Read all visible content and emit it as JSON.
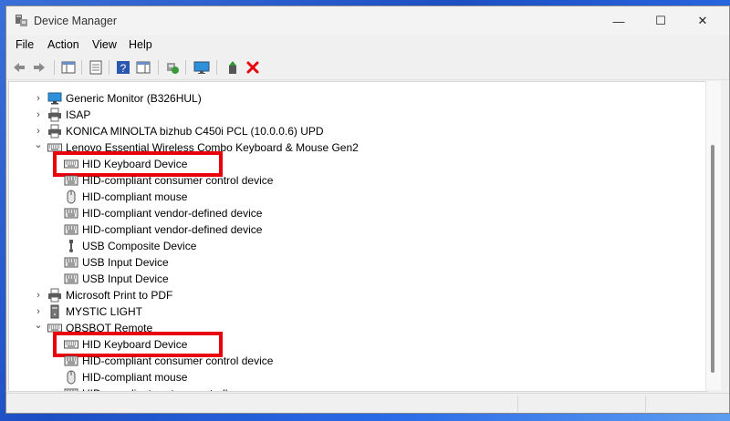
{
  "window": {
    "title": "Device Manager"
  },
  "window_controls": {
    "minimize": "—",
    "maximize": "☐",
    "close": "✕"
  },
  "menu": [
    "File",
    "Action",
    "View",
    "Help"
  ],
  "tree": {
    "rows": [
      {
        "label": "Generic Monitor (B326HUL)",
        "indent": 1,
        "icon": "monitor-icon",
        "expander": "collapsed"
      },
      {
        "label": "ISAP",
        "indent": 1,
        "icon": "printer-icon",
        "expander": "collapsed"
      },
      {
        "label": "KONICA MINOLTA bizhub C450i PCL (10.0.0.6) UPD",
        "indent": 1,
        "icon": "printer-icon",
        "expander": "collapsed"
      },
      {
        "label": "Lenovo Essential Wireless Combo Keyboard & Mouse Gen2",
        "indent": 1,
        "icon": "keyboard-icon",
        "expander": "expanded"
      },
      {
        "label": "HID Keyboard Device",
        "indent": 2,
        "icon": "keyboard-icon",
        "expander": "none"
      },
      {
        "label": "HID-compliant consumer control device",
        "indent": 2,
        "icon": "hid-icon",
        "expander": "none"
      },
      {
        "label": "HID-compliant mouse",
        "indent": 2,
        "icon": "mouse-icon",
        "expander": "none"
      },
      {
        "label": "HID-compliant vendor-defined device",
        "indent": 2,
        "icon": "hid-icon",
        "expander": "none"
      },
      {
        "label": "HID-compliant vendor-defined device",
        "indent": 2,
        "icon": "hid-icon",
        "expander": "none"
      },
      {
        "label": "USB Composite Device",
        "indent": 2,
        "icon": "usb-icon",
        "expander": "none"
      },
      {
        "label": "USB Input Device",
        "indent": 2,
        "icon": "hid-icon",
        "expander": "none"
      },
      {
        "label": "USB Input Device",
        "indent": 2,
        "icon": "hid-icon",
        "expander": "none"
      },
      {
        "label": "Microsoft Print to PDF",
        "indent": 1,
        "icon": "printer-icon",
        "expander": "collapsed"
      },
      {
        "label": "MYSTIC LIGHT",
        "indent": 1,
        "icon": "tower-icon",
        "expander": "collapsed"
      },
      {
        "label": "OBSBOT Remote",
        "indent": 1,
        "icon": "keyboard-icon",
        "expander": "expanded"
      },
      {
        "label": "HID Keyboard Device",
        "indent": 2,
        "icon": "keyboard-icon",
        "expander": "none"
      },
      {
        "label": "HID-compliant consumer control device",
        "indent": 2,
        "icon": "hid-icon",
        "expander": "none"
      },
      {
        "label": "HID-compliant mouse",
        "indent": 2,
        "icon": "mouse-icon",
        "expander": "none"
      },
      {
        "label": "HID-compliant system controller",
        "indent": 2,
        "icon": "hid-icon",
        "expander": "none"
      }
    ]
  },
  "annotations": {
    "highlight_color": "#e8000b",
    "highlighted_rows": [
      4,
      15
    ]
  },
  "colors": {
    "accent_red": "#e8000b",
    "monitor_blue": "#2f8fd8"
  }
}
